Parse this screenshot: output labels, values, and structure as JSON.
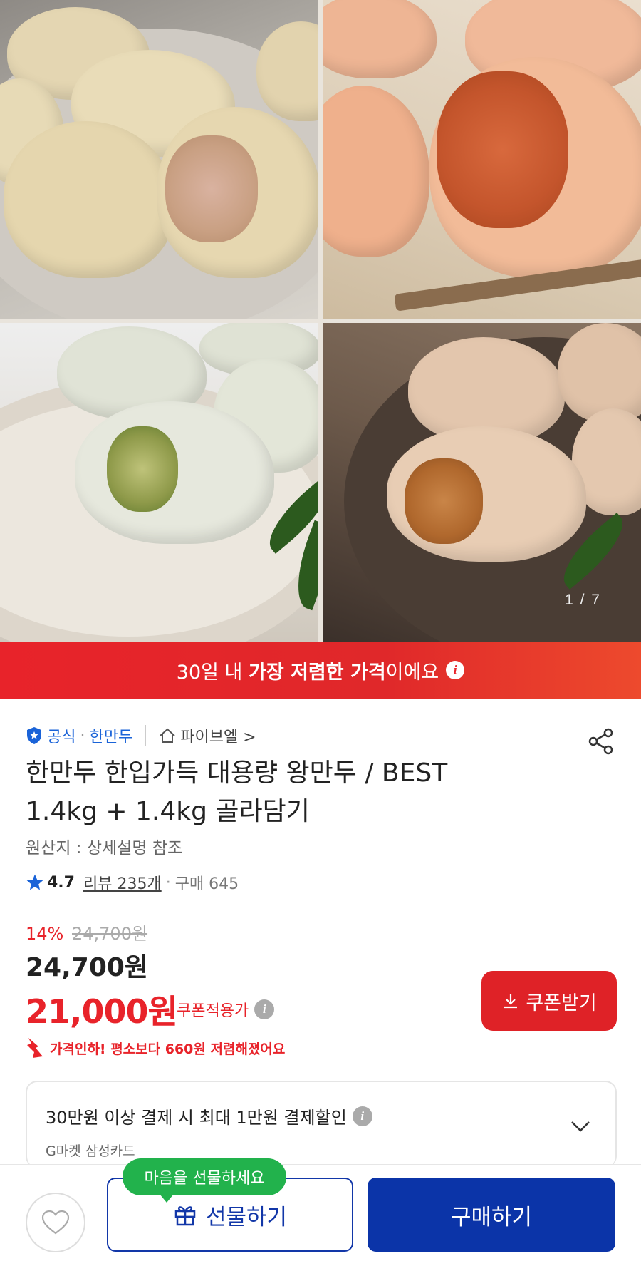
{
  "gallery": {
    "counter": "1 / 7",
    "images": [
      "meat-dumplings",
      "kimchi-dumplings",
      "vegetable-dumplings",
      "spicy-dumplings"
    ]
  },
  "banner": {
    "prefix": "30일 내 ",
    "highlight": "가장 저렴한 가격",
    "suffix": "이에요"
  },
  "seller": {
    "official_label": "공식",
    "brand": "한만두",
    "store": "파이브엘 >"
  },
  "product": {
    "title_line1": "한만두 한입가득 대용량 왕만두 / BEST",
    "title_line2": "1.4kg + 1.4kg 골라담기",
    "origin": "원산지 : 상세설명 참조",
    "rating": "4.7",
    "reviews": "리뷰 235개",
    "purchases": "구매 645"
  },
  "price": {
    "discount_rate": "14%",
    "original": "24,700원",
    "sale": "24,700원",
    "coupon_price": "21,000원",
    "coupon_label": "쿠폰적용가",
    "coupon_button": "쿠폰받기",
    "price_drop": "가격인하! 평소보다 660원 저렴해졌어요"
  },
  "card_offer": {
    "main": "30만원 이상 결제 시 최대 1만원 결제할인",
    "sub": "G마켓 삼성카드"
  },
  "bottom": {
    "tooltip": "마음을 선물하세요",
    "gift_button": "선물하기",
    "buy_button": "구매하기"
  },
  "colors": {
    "accent_red": "#e8232a",
    "brand_blue": "#0b34a8",
    "link_blue": "#1a63d8",
    "tooltip_green": "#22b24c"
  }
}
